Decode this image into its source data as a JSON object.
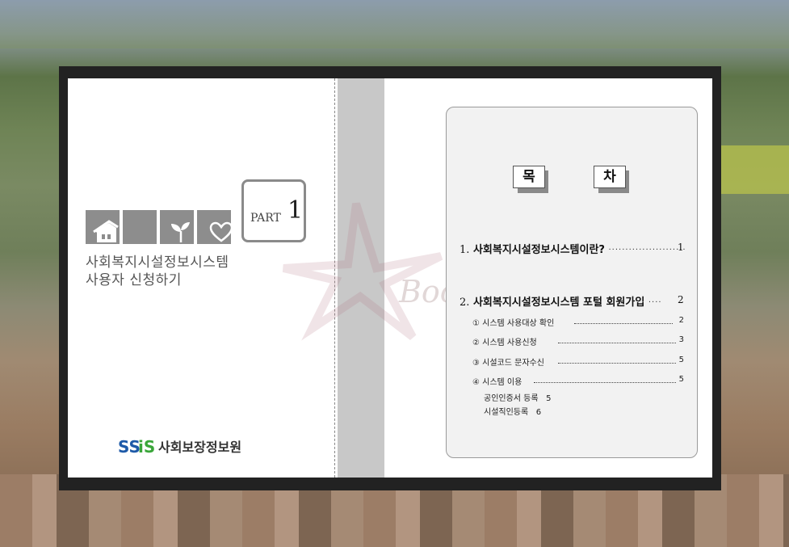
{
  "left_page": {
    "part_label": "PART",
    "part_number": "1",
    "title_line1": "사회복지시설정보시스템",
    "title_line2": "사용자 신청하기",
    "logo_mark": "SSiS",
    "logo_org": "사회보장정보원",
    "tile_icons": [
      "house-icon",
      "blank-tile",
      "sprout-icon",
      "heart-icon"
    ]
  },
  "watermark": {
    "text": "Book"
  },
  "toc": {
    "heading_chars": [
      "목",
      "차"
    ],
    "sections": [
      {
        "num": "1.",
        "title": "사회복지시설정보시스템이란?",
        "dots": "·······················",
        "page": "1"
      },
      {
        "num": "2.",
        "title": "사회복지시설정보시스템 포털 회원가입",
        "dots": "····",
        "page": "2"
      }
    ],
    "subitems": [
      {
        "label": "① 시스템 사용대상 확인",
        "page": "2"
      },
      {
        "label": "② 시스템 사용신청",
        "page": "3"
      },
      {
        "label": "③ 시설코드 문자수신",
        "page": "5"
      },
      {
        "label": "④ 시스템 이용",
        "page": "5"
      }
    ],
    "plain_items": [
      {
        "label": "공인인증서 등록",
        "page": "5"
      },
      {
        "label": "시설직인등록",
        "page": "6"
      }
    ]
  },
  "colors": {
    "tile_gray": "#8d8d8d",
    "frame": "#222222",
    "spine": "#c8c8c8",
    "logo_blue": "#1e5aa8",
    "logo_green": "#3aa63a"
  }
}
